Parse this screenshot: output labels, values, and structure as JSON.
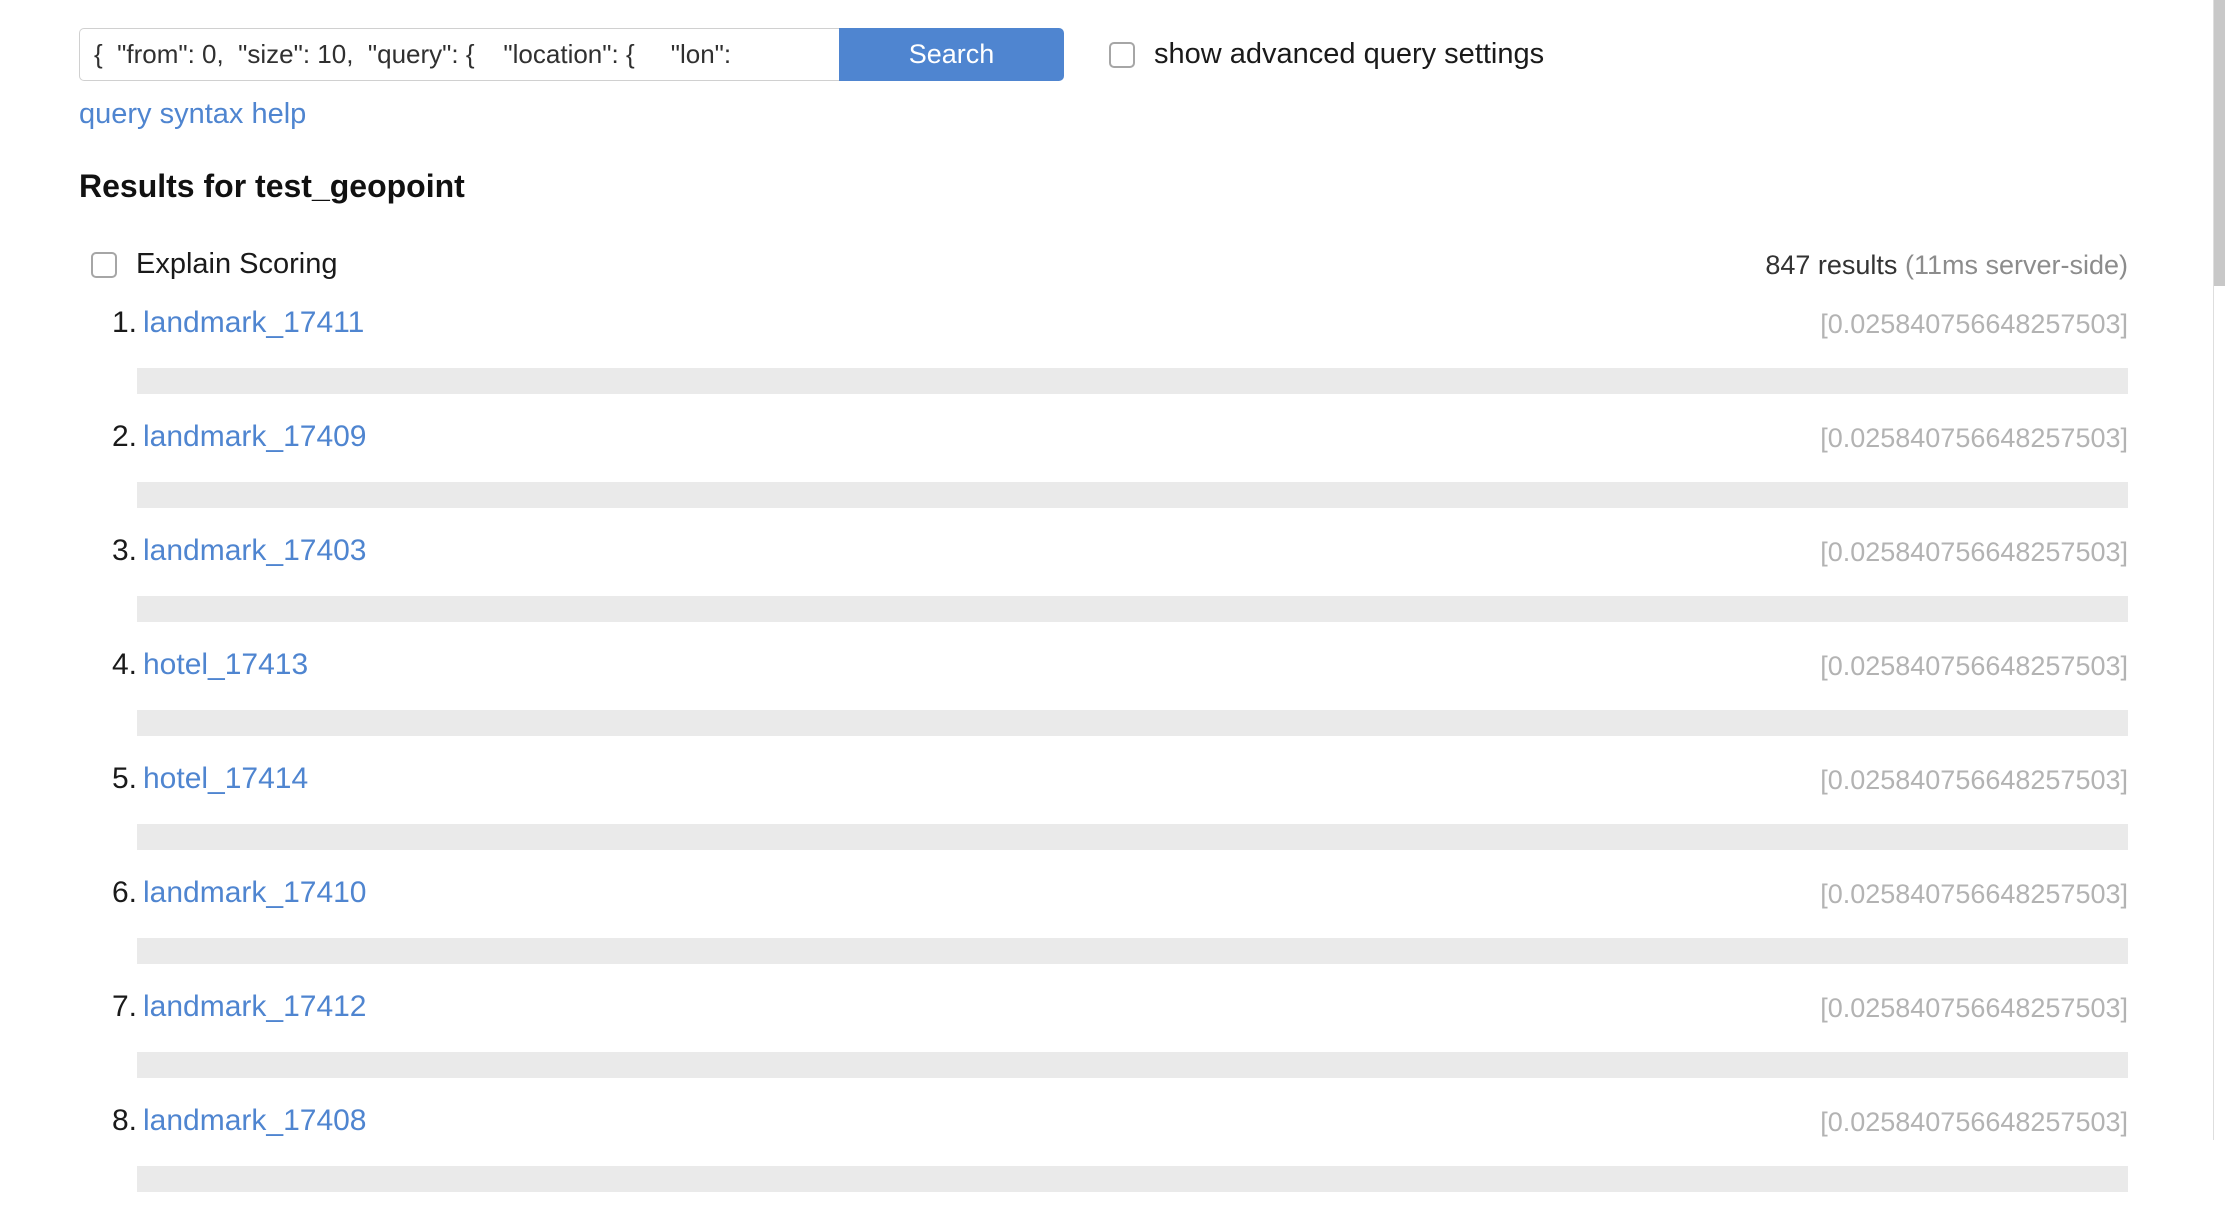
{
  "search": {
    "query_value": "{  \"from\": 0,  \"size\": 10,  \"query\": {    \"location\": {     \"lon\":",
    "query_placeholder": "query",
    "search_button_label": "Search",
    "advanced_toggle_label": "show advanced query settings",
    "syntax_help_label": "query syntax help"
  },
  "results_header": {
    "title": "Results for test_geopoint",
    "explain_scoring_label": "Explain Scoring",
    "result_count": "847 results",
    "timing": "(11ms server-side)"
  },
  "results": [
    {
      "rank": "1.",
      "name": "landmark_17411",
      "score": "[0.025840756648257503]"
    },
    {
      "rank": "2.",
      "name": "landmark_17409",
      "score": "[0.025840756648257503]"
    },
    {
      "rank": "3.",
      "name": "landmark_17403",
      "score": "[0.025840756648257503]"
    },
    {
      "rank": "4.",
      "name": "hotel_17413",
      "score": "[0.025840756648257503]"
    },
    {
      "rank": "5.",
      "name": "hotel_17414",
      "score": "[0.025840756648257503]"
    },
    {
      "rank": "6.",
      "name": "landmark_17410",
      "score": "[0.025840756648257503]"
    },
    {
      "rank": "7.",
      "name": "landmark_17412",
      "score": "[0.025840756648257503]"
    },
    {
      "rank": "8.",
      "name": "landmark_17408",
      "score": "[0.025840756648257503]"
    }
  ],
  "colors": {
    "accent": "#4f85d0",
    "link": "#4f85d0",
    "bar": "#eaeaea",
    "score_text": "#b3b3b3",
    "muted_text": "#8c8c8c"
  }
}
